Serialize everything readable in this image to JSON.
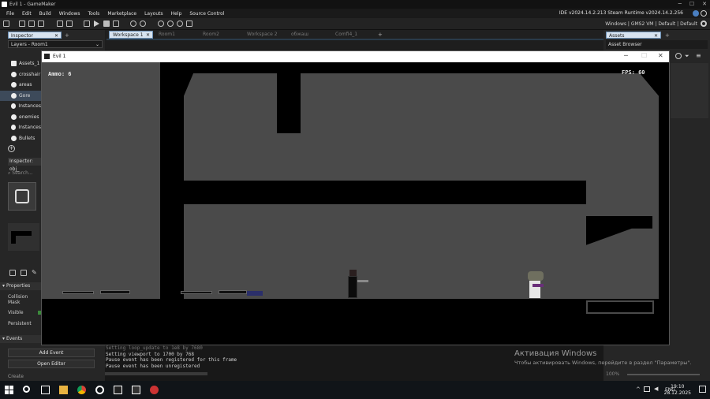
{
  "window": {
    "title": "Evil 1 - GameMaker"
  },
  "menu": [
    "File",
    "Edit",
    "Build",
    "Windows",
    "Tools",
    "Marketplace",
    "Layouts",
    "Help",
    "Source Control"
  ],
  "ide_version": "IDE v2024.14.2.213  Steam  Runtime v2024.14.2.256",
  "target": "Windows | GMS2 VM | Default | Default",
  "left_panel": {
    "inspector_tab": "Inspector",
    "layers_dropdown": "Layers - Room1",
    "layers": [
      "Assets_1",
      "crosshair",
      "areas",
      "Gore",
      "Instances",
      "enemies",
      "Instances",
      "Bullets"
    ],
    "selected_layer_index": 3,
    "inspector_obj": "Inspector: obj_",
    "search_placeholder": "Search...",
    "properties_header": "Properties",
    "collision_mask": "Collision Mask",
    "visible": "Visible",
    "persistent": "Persistent",
    "events_header": "Events",
    "add_event": "Add Event",
    "open_editor": "Open Editor",
    "create_label": "Create"
  },
  "workspace_tabs": [
    "Workspace 1",
    "Room1",
    "Room2",
    "Workspace 2",
    "обжаш",
    "Сomfi4_1"
  ],
  "right_panel": {
    "assets_tab": "Assets",
    "asset_browser": "Asset Browser"
  },
  "game_window": {
    "title": "Evil 1",
    "ammo": "Ammo: 6",
    "fps": "FPS: 60"
  },
  "output_lines": [
    "Setting loop_update to 1e8 by 7680",
    "Setting viewport to 1700 by 768",
    "Pause event has been registered for this frame",
    "Pause event has been unregistered"
  ],
  "zoom": "100%",
  "watermark": {
    "line1": "Активация Windows",
    "line2": "Чтобы активировать Windows, перейдите в раздел \"Параметры\"."
  },
  "taskbar": {
    "lang": "ENG",
    "time": "19:10",
    "date": "28.12.2025"
  },
  "colors": {
    "accent": "#d7e3ef",
    "wall": "#4a4a4a",
    "background": "#000000"
  }
}
